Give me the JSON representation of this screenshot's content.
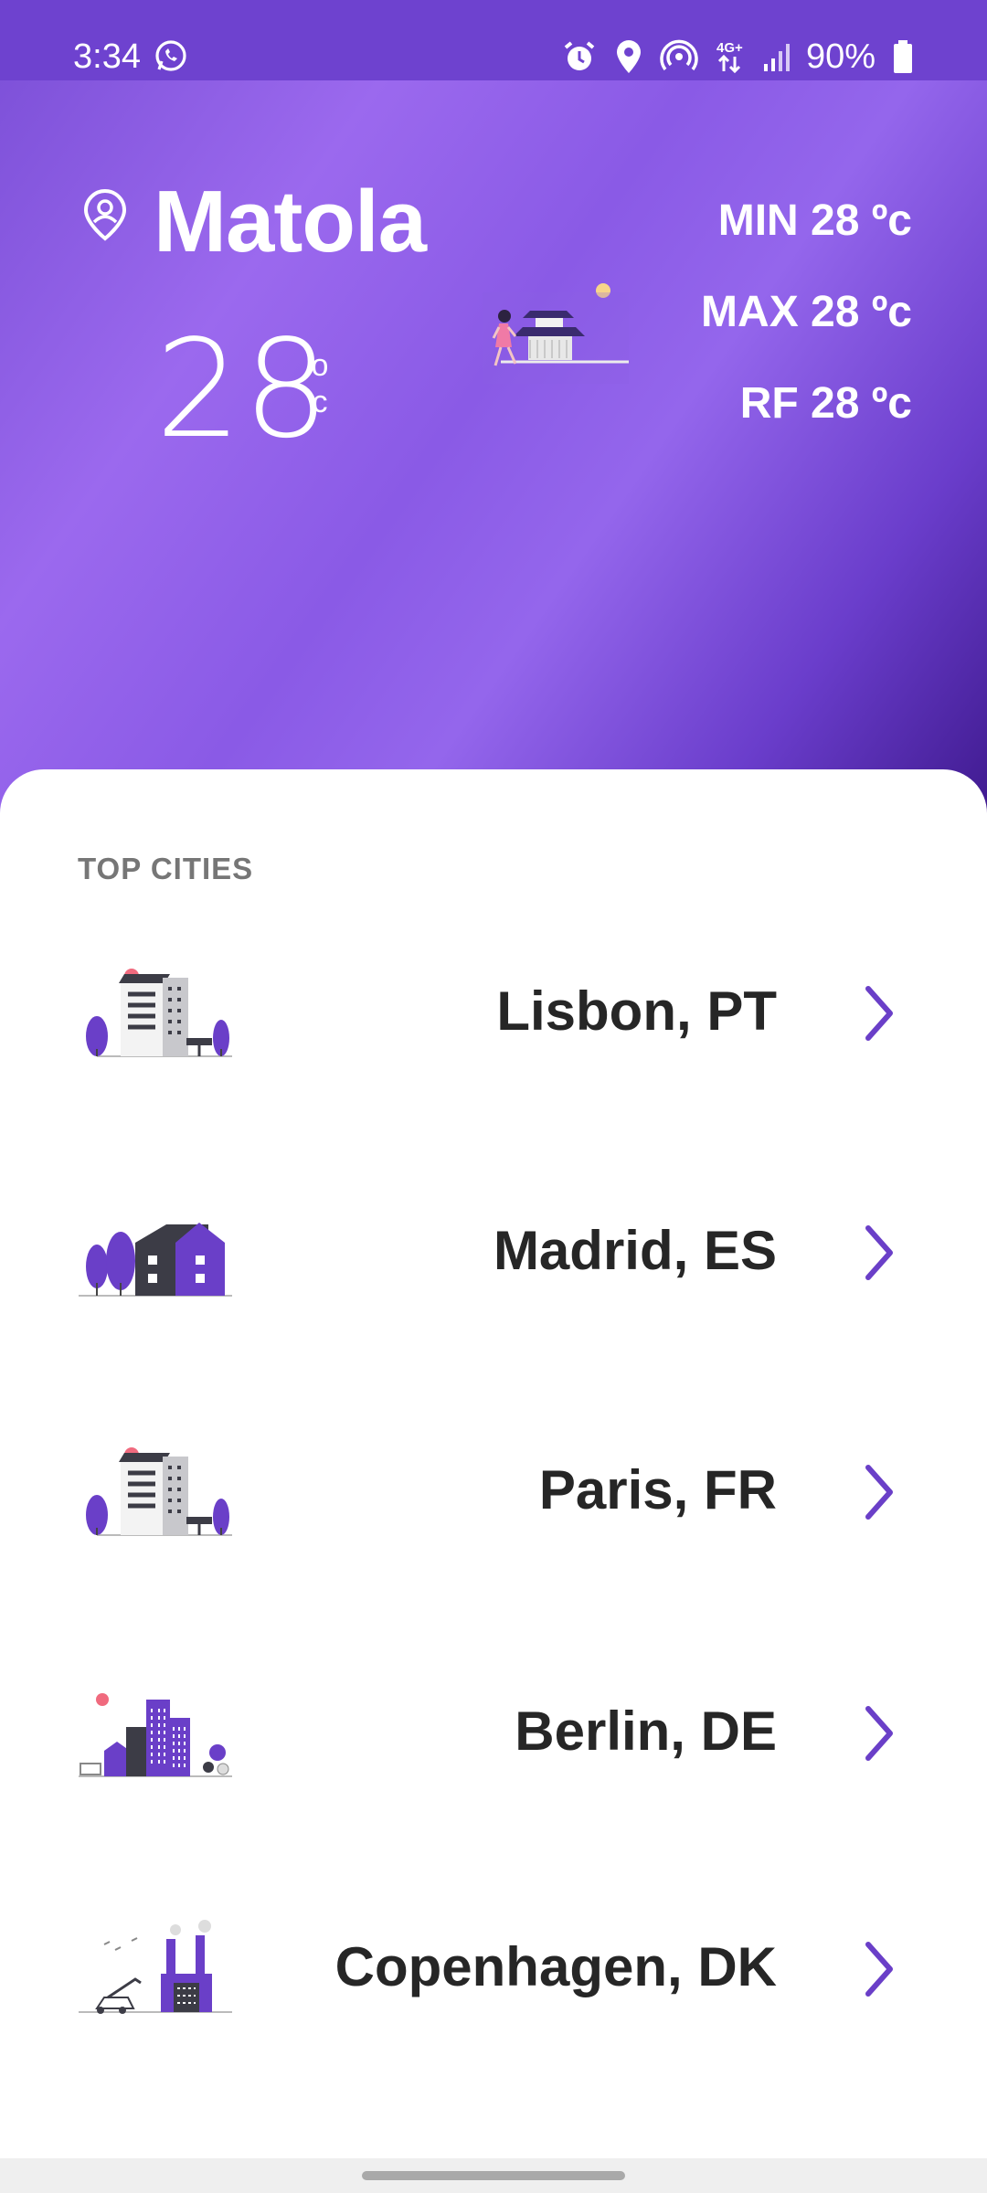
{
  "status_bar": {
    "time": "3:34",
    "battery": "90%",
    "icons": [
      "whatsapp-icon",
      "alarm-icon",
      "location-icon",
      "hotspot-icon",
      "4g-icon",
      "signal-icon",
      "battery-icon"
    ]
  },
  "weather": {
    "city": "Matola",
    "temperature": "28",
    "unit_top": "o",
    "unit_bottom": "c",
    "min": "MIN 28 ºc",
    "max": "MAX 28 ºc",
    "rf": "RF 28 ºc"
  },
  "top_cities": {
    "title": "TOP CITIES",
    "items": [
      {
        "label": "Lisbon, PT"
      },
      {
        "label": "Madrid, ES"
      },
      {
        "label": "Paris, FR"
      },
      {
        "label": "Berlin, DE"
      },
      {
        "label": "Copenhagen, DK"
      }
    ]
  },
  "colors": {
    "accent": "#6a3fc8",
    "hero_gradient_start": "#7a4ed6",
    "hero_gradient_end": "#3f1a8f",
    "text_dark": "#262626"
  }
}
